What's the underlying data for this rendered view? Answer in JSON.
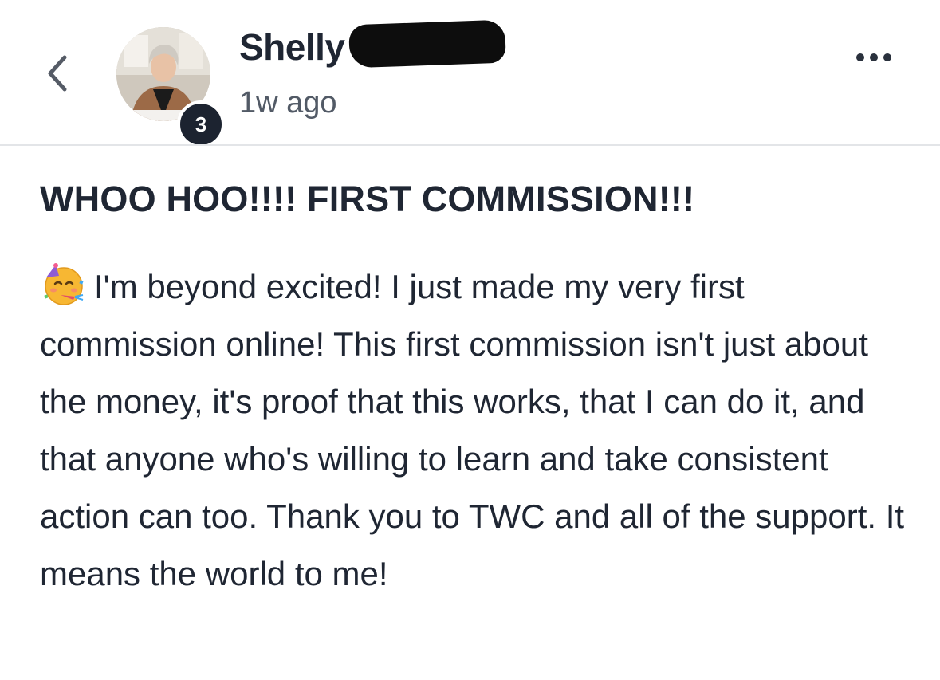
{
  "header": {
    "author_first_name": "Shelly",
    "author_level": "3",
    "post_time": "1w ago",
    "icons": {
      "back": "chevron-left-icon",
      "more": "more-horizontal-icon",
      "emoji": "partying-face-emoji-icon"
    }
  },
  "post": {
    "title": "WHOO HOO!!!! FIRST COMMISSION!!!",
    "body": "I'm beyond excited! I just made my very first commission online! This first commission isn't just about the money, it's proof that this works, that I can do it, and that anyone who's willing to learn and take consistent action can too. Thank you to TWC and all of the support. It means the world to me!"
  },
  "colors": {
    "text_primary": "#1f2633",
    "text_secondary": "#525a66",
    "badge_bg": "#1c2330",
    "divider": "#e3e5e8"
  }
}
